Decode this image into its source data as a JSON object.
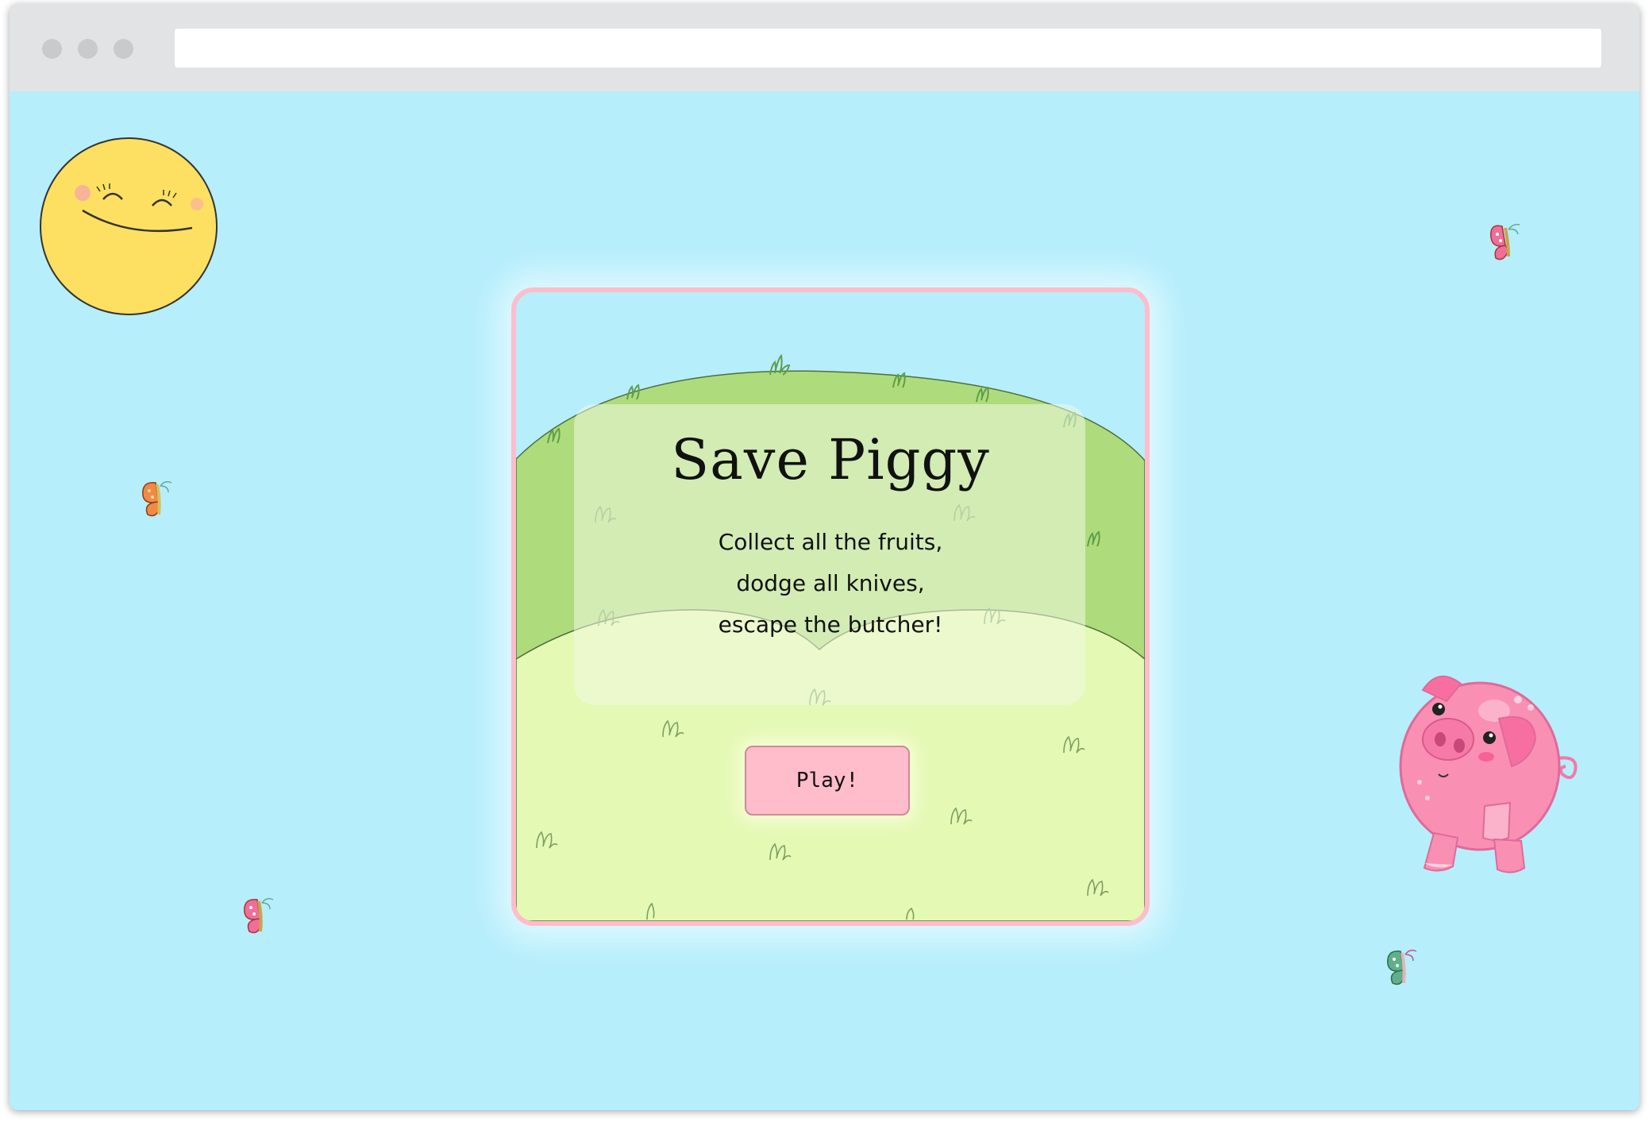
{
  "browser": {
    "url": ""
  },
  "game": {
    "title": "Save Piggy",
    "tagline_lines": [
      "Collect all the fruits,",
      "dodge all knives,",
      "escape the butcher!"
    ],
    "play_label": "Play!"
  },
  "colors": {
    "sky": "#b6eefc",
    "card_border": "#ffbccb",
    "hill_back": "#aedc7c",
    "hill_front": "#e4f9b4",
    "button": "#ffbccb",
    "sun": "#fde061",
    "pig": "#f98fb3"
  },
  "decorations": {
    "sun": "smiling-sun-icon",
    "pig": "pig-character-icon",
    "butterflies": [
      "butterfly-pink-icon",
      "butterfly-orange-icon",
      "butterfly-pink-icon",
      "butterfly-green-icon"
    ]
  }
}
